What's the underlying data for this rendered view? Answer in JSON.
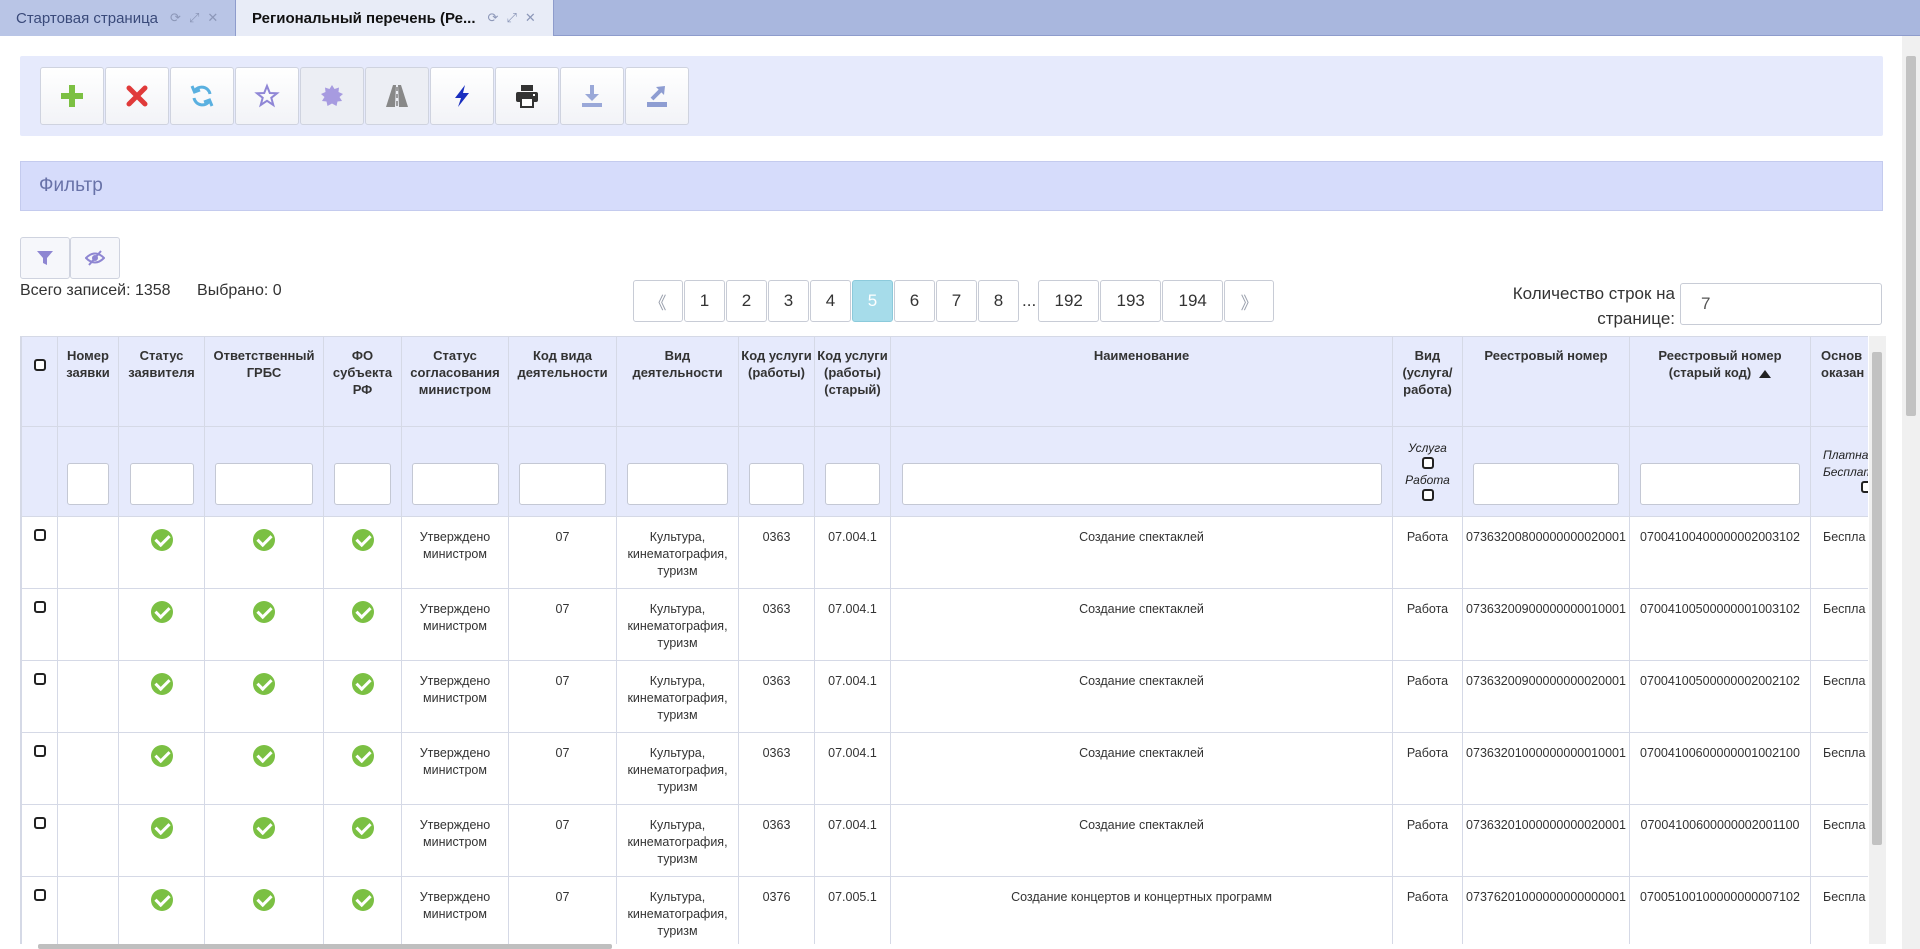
{
  "tabs": [
    {
      "label": "Стартовая страница",
      "active": false
    },
    {
      "label": "Региональный перечень (Ре...",
      "active": true
    }
  ],
  "toolbar": {
    "buttons": [
      {
        "name": "add",
        "icon": "plus-icon",
        "color": "#7cc043"
      },
      {
        "name": "delete",
        "icon": "close-icon",
        "color": "#e03a3a"
      },
      {
        "name": "refresh",
        "icon": "refresh-icon",
        "color": "#5ab0e0"
      },
      {
        "name": "favorite",
        "icon": "star-icon",
        "color": "#8f86d6"
      },
      {
        "name": "seal",
        "icon": "seal-icon",
        "color": "#a79be0"
      },
      {
        "name": "road",
        "icon": "road-icon",
        "color": "#888888"
      },
      {
        "name": "lightning",
        "icon": "lightning-icon",
        "color": "#1a2fbf"
      },
      {
        "name": "print",
        "icon": "printer-icon",
        "color": "#333333"
      },
      {
        "name": "download",
        "icon": "download-icon",
        "color": "#9aa8d8"
      },
      {
        "name": "export",
        "icon": "export-icon",
        "color": "#8e9dd2"
      }
    ]
  },
  "filter_panel": {
    "title": "Фильтр"
  },
  "stats": {
    "total": "Всего записей: 1358",
    "selected": "Выбрано: 0"
  },
  "pagination": {
    "prev": "《",
    "next": "》",
    "pages": [
      "1",
      "2",
      "3",
      "4",
      "5",
      "6",
      "7",
      "8"
    ],
    "ellipsis": "...",
    "last_pages": [
      "192",
      "193",
      "194"
    ],
    "current": "5"
  },
  "rows_per_page": {
    "label": "Количество строк на странице:",
    "value": "7"
  },
  "table": {
    "columns": [
      "Номер заявки",
      "Статус заявителя",
      "Ответственный ГРБС",
      "ФО субъекта РФ",
      "Статус согласования министром",
      "Код вида деятельности",
      "Вид деятельности",
      "Код услуги (работы)",
      "Код услуги (работы) (старый)",
      "Наименование",
      "Вид (услуга/ работа)",
      "Реестровый номер",
      "Реестровый номер (старый код)",
      "Основ оказан"
    ],
    "filter_options": {
      "kind": [
        "Услуга",
        "Работа"
      ],
      "basis": [
        "Платна",
        "Бесплат"
      ]
    },
    "rows": [
      {
        "status": "Утверждено министром",
        "activity_code": "07",
        "activity": "Культура, кинематография, туризм",
        "service_code": "0363",
        "service_code_old": "07.004.1",
        "name": "Создание спектаклей",
        "kind": "Работа",
        "reg_number": "07363200800000000020001",
        "reg_number_old": "07004100400000002003102",
        "basis": "Беспла"
      },
      {
        "status": "Утверждено министром",
        "activity_code": "07",
        "activity": "Культура, кинематография, туризм",
        "service_code": "0363",
        "service_code_old": "07.004.1",
        "name": "Создание спектаклей",
        "kind": "Работа",
        "reg_number": "07363200900000000010001",
        "reg_number_old": "07004100500000001003102",
        "basis": "Беспла"
      },
      {
        "status": "Утверждено министром",
        "activity_code": "07",
        "activity": "Культура, кинематография, туризм",
        "service_code": "0363",
        "service_code_old": "07.004.1",
        "name": "Создание спектаклей",
        "kind": "Работа",
        "reg_number": "07363200900000000020001",
        "reg_number_old": "07004100500000002002102",
        "basis": "Беспла"
      },
      {
        "status": "Утверждено министром",
        "activity_code": "07",
        "activity": "Культура, кинематография, туризм",
        "service_code": "0363",
        "service_code_old": "07.004.1",
        "name": "Создание спектаклей",
        "kind": "Работа",
        "reg_number": "07363201000000000010001",
        "reg_number_old": "07004100600000001002100",
        "basis": "Беспла"
      },
      {
        "status": "Утверждено министром",
        "activity_code": "07",
        "activity": "Культура, кинематография, туризм",
        "service_code": "0363",
        "service_code_old": "07.004.1",
        "name": "Создание спектаклей",
        "kind": "Работа",
        "reg_number": "07363201000000000020001",
        "reg_number_old": "07004100600000002001100",
        "basis": "Беспла"
      },
      {
        "status": "Утверждено министром",
        "activity_code": "07",
        "activity": "Культура, кинематография, туризм",
        "service_code": "0376",
        "service_code_old": "07.005.1",
        "name": "Создание концертов и концертных программ",
        "kind": "Работа",
        "reg_number": "07376201000000000000001",
        "reg_number_old": "07005100100000000007102",
        "basis": "Беспла"
      }
    ]
  }
}
